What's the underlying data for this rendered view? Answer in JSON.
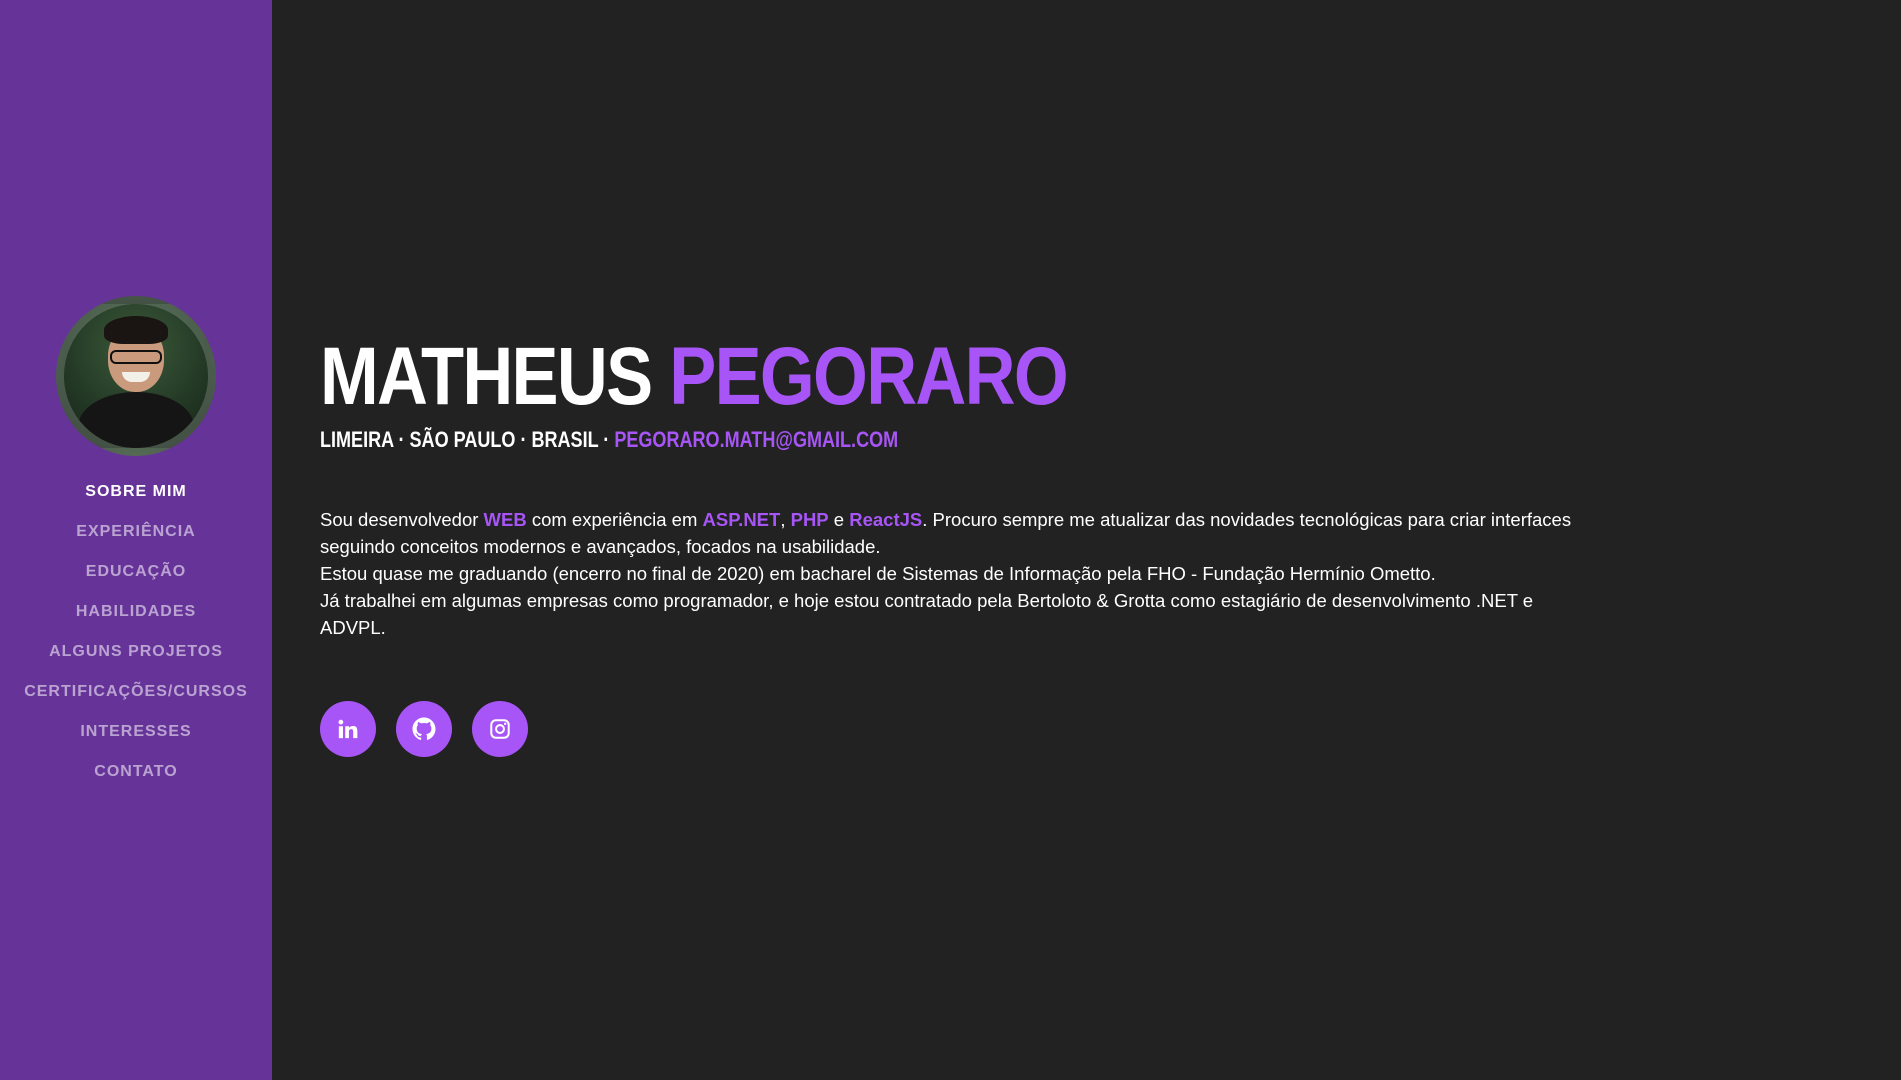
{
  "sidebar": {
    "nav_items": [
      {
        "label": "Sobre Mim",
        "active": true
      },
      {
        "label": "Experiência",
        "active": false
      },
      {
        "label": "Educação",
        "active": false
      },
      {
        "label": "Habilidades",
        "active": false
      },
      {
        "label": "Alguns Projetos",
        "active": false
      },
      {
        "label": "Certificações/Cursos",
        "active": false
      },
      {
        "label": "Interesses",
        "active": false
      },
      {
        "label": "Contato",
        "active": false
      }
    ]
  },
  "about": {
    "first_name": "Matheus",
    "last_name": "Pegoraro",
    "location": "Limeira · São Paulo · Brasil ·",
    "email": "pegoraro.math@gmail.com",
    "para1": {
      "t1": "Sou desenvolvedor ",
      "h1": "WEB",
      "t2": " com experiência em ",
      "h2": "ASP.NET",
      "t3": ", ",
      "h3": "PHP",
      "t4": " e ",
      "h4": "ReactJS",
      "t5": ". Procuro sempre me atualizar das novidades tecnológicas para criar interfaces seguindo conceitos modernos e avançados, focados na usabilidade."
    },
    "para2": "Estou quase me graduando (encerro no final de 2020) em bacharel de Sistemas de Informação pela FHO - Fundação Hermínio Ometto.",
    "para3": "Já trabalhei em algumas empresas como programador, e hoje estou contratado pela Bertoloto & Grotta como estagiário de desenvolvimento .NET e ADVPL."
  },
  "social": [
    {
      "icon": "linkedin-icon"
    },
    {
      "icon": "github-icon"
    },
    {
      "icon": "instagram-icon"
    }
  ],
  "colors": {
    "sidebar_bg": "#663399",
    "page_bg": "#222222",
    "accent": "#a855f7",
    "text": "#ffffff"
  }
}
